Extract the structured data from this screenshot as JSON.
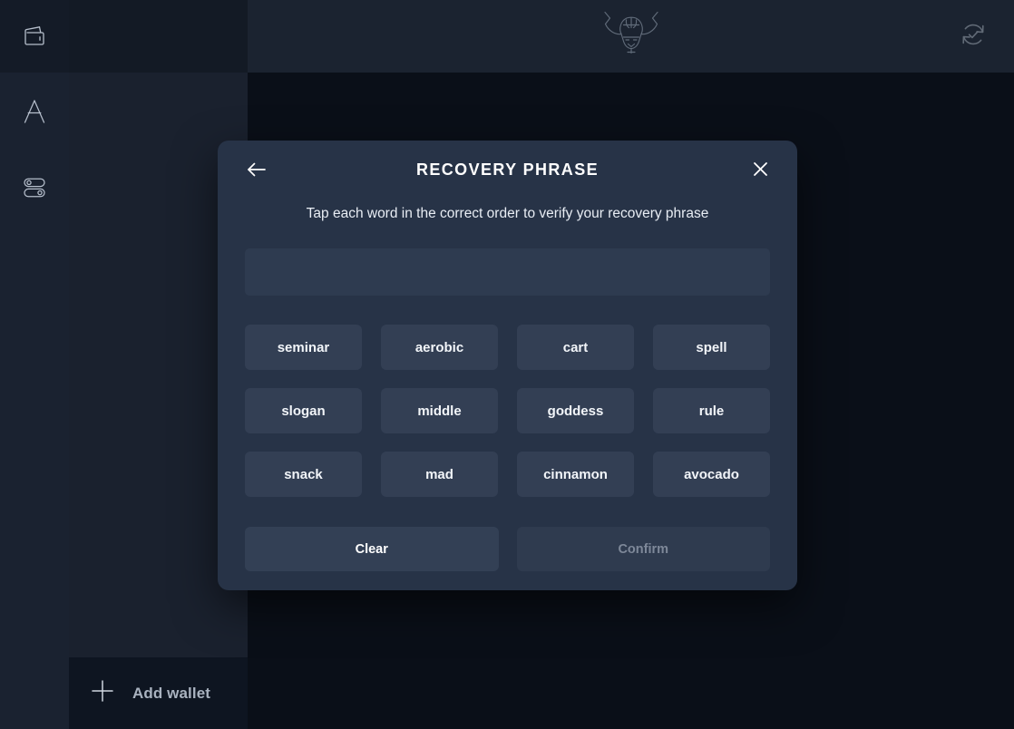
{
  "app": {
    "background_color": "#0a0f18",
    "panel_color": "#1a212e",
    "modal_color": "#273347",
    "accent_text_color": "#ffffff"
  },
  "sidebar": {
    "items": [
      {
        "icon": "wallet-icon",
        "label": "Wallet"
      },
      {
        "icon": "avalanche-a-icon",
        "label": "Assets"
      },
      {
        "icon": "toggles-settings-icon",
        "label": "Settings"
      }
    ],
    "add_wallet": {
      "icon": "plus-icon",
      "label": "Add wallet"
    }
  },
  "header": {
    "logo": "bull-head-logo",
    "refresh": {
      "icon": "refresh-check-icon",
      "label": "Refresh"
    }
  },
  "modal": {
    "title": "RECOVERY PHRASE",
    "subtitle": "Tap each word in the correct order to verify your recovery phrase",
    "back": {
      "icon": "arrow-left-icon",
      "label": "Back"
    },
    "close": {
      "icon": "close-icon",
      "label": "Close"
    },
    "answer_box": {
      "value": "",
      "placeholder": ""
    },
    "words": [
      "seminar",
      "aerobic",
      "cart",
      "spell",
      "slogan",
      "middle",
      "goddess",
      "rule",
      "snack",
      "mad",
      "cinnamon",
      "avocado"
    ],
    "actions": {
      "clear_label": "Clear",
      "confirm_label": "Confirm",
      "confirm_enabled": false
    }
  }
}
